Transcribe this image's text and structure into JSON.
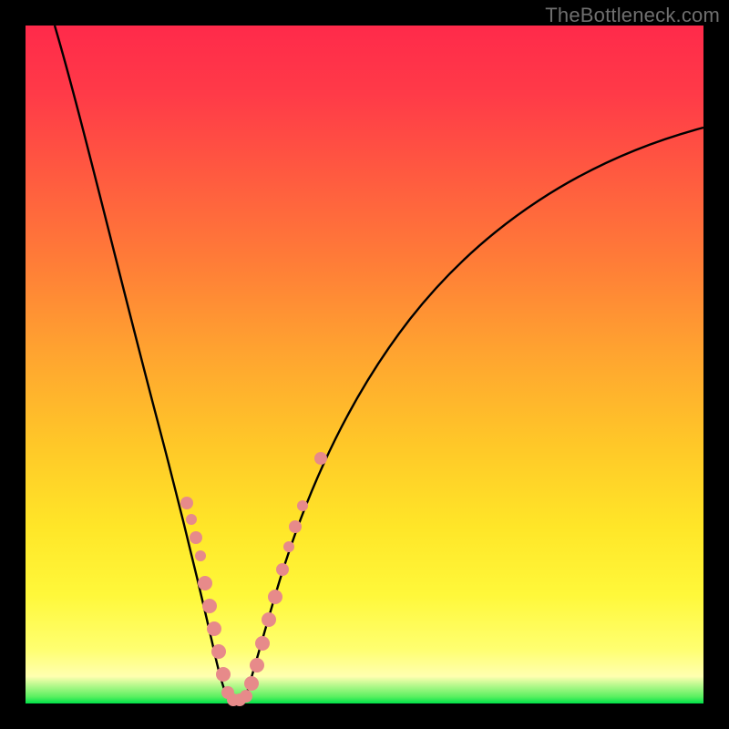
{
  "watermark": "TheBottleneck.com",
  "chart_data": {
    "type": "line",
    "title": "",
    "xlabel": "",
    "ylabel": "",
    "xlim": [
      0,
      100
    ],
    "ylim": [
      0,
      100
    ],
    "gradient_colors": {
      "top": "#ff2a4a",
      "mid": "#ffe628",
      "bottom_band": "#00e048"
    },
    "series": [
      {
        "name": "left-curve",
        "x": [
          4,
          6,
          9,
          12,
          15,
          18,
          20,
          22,
          24,
          25.5,
          27,
          28
        ],
        "y": [
          100,
          88,
          75,
          62,
          50,
          38,
          29,
          20,
          12,
          6,
          2,
          0
        ]
      },
      {
        "name": "right-curve",
        "x": [
          30.5,
          32,
          34,
          37,
          41,
          46,
          53,
          62,
          73,
          86,
          100
        ],
        "y": [
          0,
          5,
          12,
          22,
          33,
          45,
          56,
          66,
          74,
          80,
          85
        ]
      }
    ],
    "markers": [
      {
        "name": "left-dots-upper",
        "color": "#e78a8a",
        "points_xy": [
          [
            21.5,
            29
          ],
          [
            22.2,
            26
          ],
          [
            23.0,
            22
          ],
          [
            23.8,
            18
          ]
        ]
      },
      {
        "name": "left-dots-lower",
        "color": "#e78a8a",
        "points_xy": [
          [
            24.8,
            12
          ],
          [
            25.5,
            8
          ],
          [
            26.2,
            5
          ],
          [
            26.9,
            3
          ],
          [
            27.6,
            1.5
          ]
        ]
      },
      {
        "name": "valley-dots",
        "color": "#e78a8a",
        "points_xy": [
          [
            28.2,
            0.5
          ],
          [
            29.0,
            0.3
          ],
          [
            29.7,
            0.3
          ],
          [
            30.3,
            0.4
          ]
        ]
      },
      {
        "name": "right-dots-lower",
        "color": "#e78a8a",
        "points_xy": [
          [
            31.0,
            1.5
          ],
          [
            31.7,
            3.5
          ],
          [
            32.4,
            6
          ],
          [
            33.2,
            9
          ],
          [
            34.0,
            12
          ]
        ]
      },
      {
        "name": "right-dots-upper",
        "color": "#e78a8a",
        "points_xy": [
          [
            35.0,
            16
          ],
          [
            35.8,
            19
          ],
          [
            36.6,
            22
          ],
          [
            37.4,
            25
          ],
          [
            40.0,
            32
          ]
        ]
      }
    ]
  }
}
